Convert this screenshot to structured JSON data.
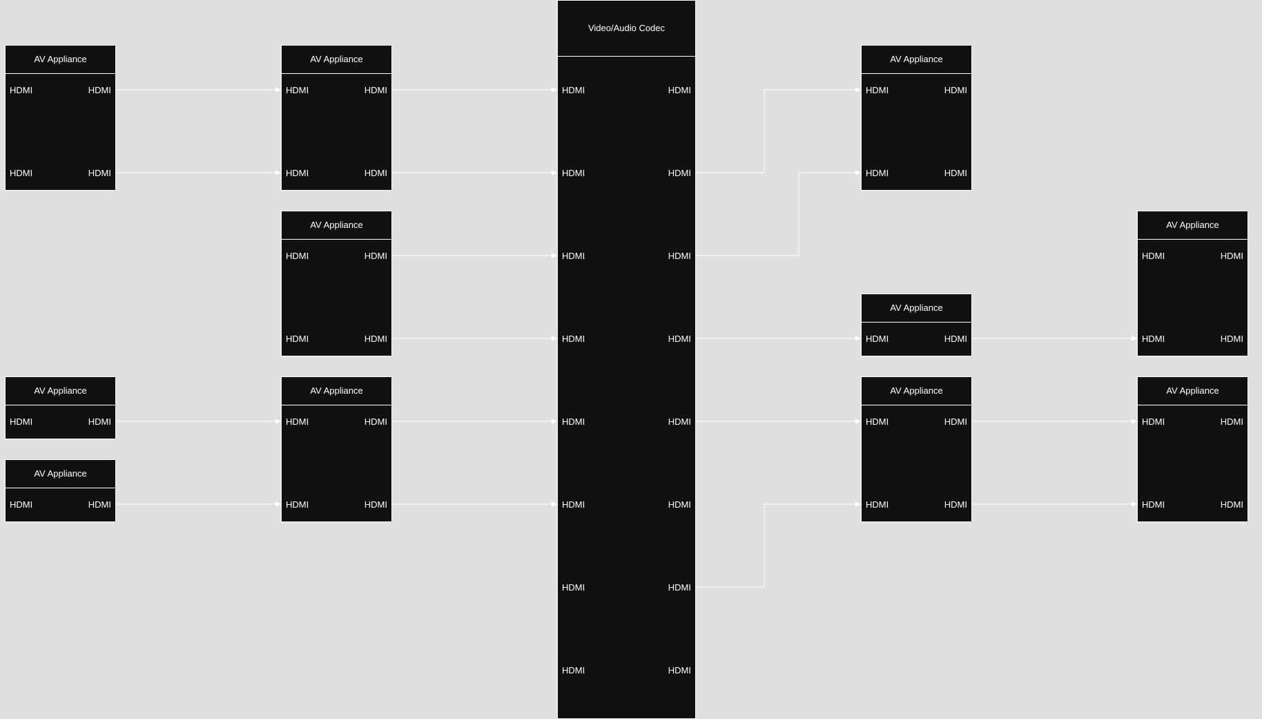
{
  "colors": {
    "background": "#dfdfdf",
    "node_fill": "#111111",
    "line": "#ffffff",
    "text": "#ffffff"
  },
  "diagram": {
    "codec": {
      "title": "Video/Audio Codec",
      "ports": [
        {
          "in": "HDMI",
          "out": "HDMI"
        },
        {
          "in": "HDMI",
          "out": "HDMI"
        },
        {
          "in": "HDMI",
          "out": "HDMI"
        },
        {
          "in": "HDMI",
          "out": "HDMI"
        },
        {
          "in": "HDMI",
          "out": "HDMI"
        },
        {
          "in": "HDMI",
          "out": "HDMI"
        },
        {
          "in": "HDMI",
          "out": "HDMI"
        },
        {
          "in": "HDMI",
          "out": "HDMI"
        }
      ]
    },
    "appliances": [
      {
        "title": "AV Appliance",
        "ports": [
          {
            "in": "HDMI",
            "out": "HDMI"
          },
          {
            "in": "HDMI",
            "out": "HDMI"
          }
        ]
      },
      {
        "title": "AV Appliance",
        "ports": [
          {
            "in": "HDMI",
            "out": "HDMI"
          }
        ]
      },
      {
        "title": "AV Appliance",
        "ports": [
          {
            "in": "HDMI",
            "out": "HDMI"
          }
        ]
      },
      {
        "title": "AV Appliance",
        "ports": [
          {
            "in": "HDMI",
            "out": "HDMI"
          },
          {
            "in": "HDMI",
            "out": "HDMI"
          }
        ]
      },
      {
        "title": "AV Appliance",
        "ports": [
          {
            "in": "HDMI",
            "out": "HDMI"
          },
          {
            "in": "HDMI",
            "out": "HDMI"
          }
        ]
      },
      {
        "title": "AV Appliance",
        "ports": [
          {
            "in": "HDMI",
            "out": "HDMI"
          },
          {
            "in": "HDMI",
            "out": "HDMI"
          }
        ]
      },
      {
        "title": "AV Appliance",
        "ports": [
          {
            "in": "HDMI",
            "out": "HDMI"
          },
          {
            "in": "HDMI",
            "out": "HDMI"
          }
        ]
      },
      {
        "title": "AV Appliance",
        "ports": [
          {
            "in": "HDMI",
            "out": "HDMI"
          }
        ]
      },
      {
        "title": "AV Appliance",
        "ports": [
          {
            "in": "HDMI",
            "out": "HDMI"
          },
          {
            "in": "HDMI",
            "out": "HDMI"
          }
        ]
      },
      {
        "title": "AV Appliance",
        "ports": [
          {
            "in": "HDMI",
            "out": "HDMI"
          },
          {
            "in": "HDMI",
            "out": "HDMI"
          }
        ]
      },
      {
        "title": "AV Appliance",
        "ports": [
          {
            "in": "HDMI",
            "out": "HDMI"
          },
          {
            "in": "HDMI",
            "out": "HDMI"
          }
        ]
      }
    ]
  }
}
